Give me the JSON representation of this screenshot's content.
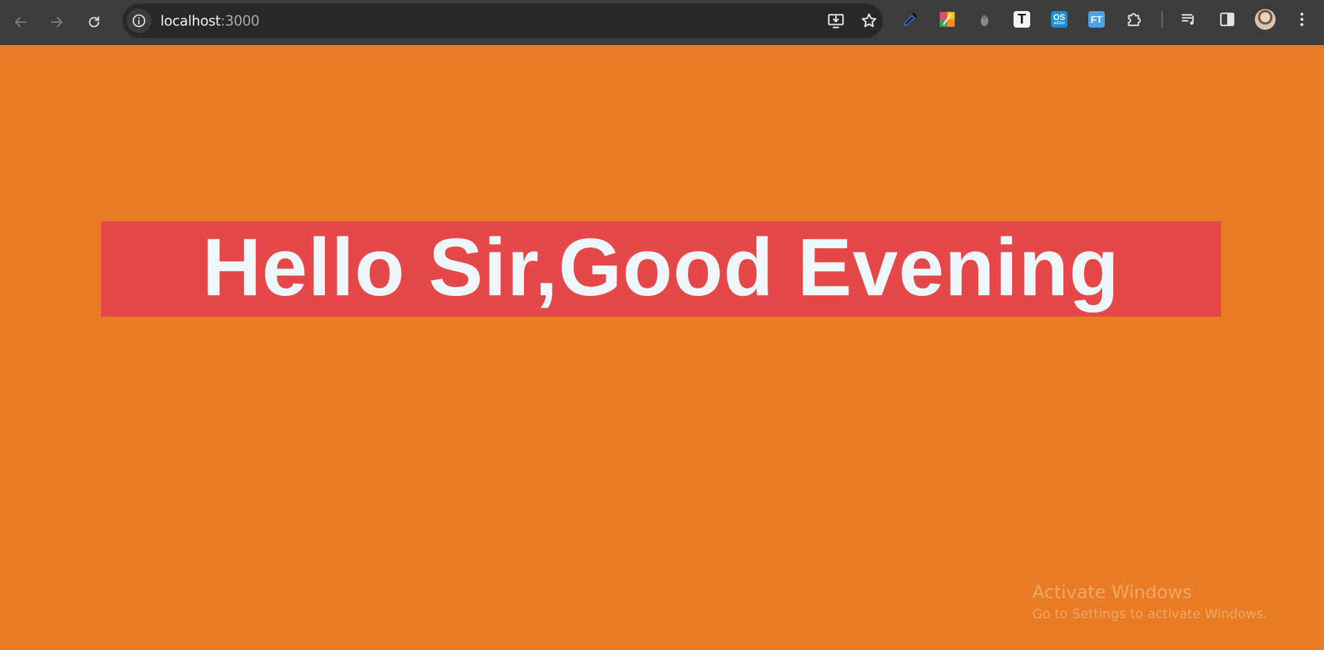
{
  "browser": {
    "url_host": "localhost",
    "url_port": ":3000",
    "nav": {
      "back_icon": "arrow-left-icon",
      "forward_icon": "arrow-right-icon",
      "reload_icon": "reload-icon"
    },
    "omnibox_icons": [
      "site-info-icon",
      "install-app-icon",
      "bookmark-star-icon"
    ],
    "extensions": [
      {
        "name": "eyedropper-icon"
      },
      {
        "name": "colorful-extension-icon"
      },
      {
        "name": "grey-extension-icon"
      },
      {
        "name": "t-extension-icon",
        "text": "T"
      },
      {
        "name": "os-addon-icon",
        "text": "OS",
        "subtext": "addon"
      },
      {
        "name": "ft-extension-icon",
        "text": "FT"
      },
      {
        "name": "puzzle-extensions-icon"
      }
    ],
    "toolbar_right": [
      "media-controls-icon",
      "side-panel-icon",
      "profile-avatar",
      "more-menu-icon"
    ],
    "colors": {
      "toolbar_bg": "#3c3c3c",
      "omnibox_bg": "#282828"
    }
  },
  "page": {
    "greeting": "Hello Sir,Good Evening",
    "colors": {
      "background": "#e87b24",
      "banner": "#e6484a",
      "text": "#eef7fb"
    }
  },
  "watermark": {
    "title": "Activate Windows",
    "subtitle": "Go to Settings to activate Windows."
  }
}
